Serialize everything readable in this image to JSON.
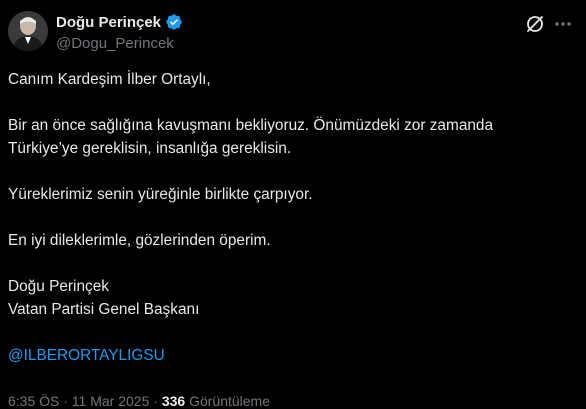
{
  "author": {
    "display_name": "Doğu Perinçek",
    "handle": "@Dogu_Perincek",
    "verified_color": "#1d9bf0"
  },
  "icons": {
    "verified": "verified-badge-icon",
    "grok": "grok-icon",
    "more": "more-options-icon"
  },
  "tweet": {
    "line1": "Canım Kardeşim İlber Ortaylı,",
    "line2": "Bir an önce sağlığına kavuşmanı bekliyoruz. Önümüzdeki zor zamanda",
    "line3": "Türkiye’ye gereklisin, insanlığa gereklisin.",
    "line4": "Yüreklerimiz senin yüreğinle birlikte çarpıyor.",
    "line5": "En iyi dileklerimle, gözlerinden öperim.",
    "signature_name": "Doğu Perinçek",
    "signature_title": "Vatan Partisi Genel Başkanı",
    "mention": "@ILBERORTAYLIGSU"
  },
  "meta": {
    "time": "6:35 ÖS · 11 Mar 2025",
    "views_count": "336",
    "views_label": "Görüntüleme"
  },
  "colors": {
    "background": "#000000",
    "text": "#e7e9ea",
    "secondary": "#71767b",
    "link": "#1d9bf0"
  }
}
